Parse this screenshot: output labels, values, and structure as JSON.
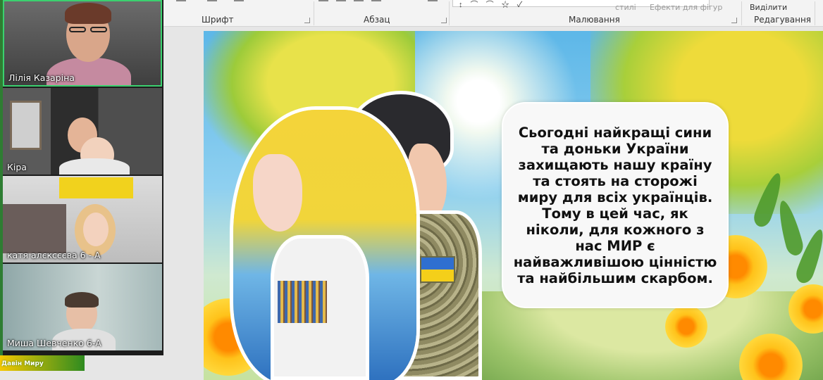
{
  "ribbon": {
    "groups": [
      {
        "label": "Шрифт"
      },
      {
        "label": "Абзац"
      },
      {
        "label": "Малювання"
      },
      {
        "label": "Редагування"
      }
    ],
    "styles_label": "стилі",
    "shape_effects_label": "Ефекти для фігур",
    "select_label": "Виділити"
  },
  "slide": {
    "text": "Сьогодні найкращі сини та доньки України захищають нашу країну та стоять на сторожі миру для всіх українців. Тому в цей час, як ніколи, для кожного з нас МИР є найважливішою цінністю та найбільшим скарбом."
  },
  "thumbnail": {
    "label": "Давін Миру"
  },
  "participants": [
    {
      "name": "Лілія Казаріна",
      "active": true
    },
    {
      "name": "Кіра",
      "active": false
    },
    {
      "name": "катя алєксєєва 6 - А",
      "active": false
    },
    {
      "name": "Миша Шевченко 6-А",
      "active": false
    }
  ],
  "colors": {
    "active_speaker_border": "#3bd16f",
    "panel_background": "#1c1c1c",
    "ribbon_background": "#f3f3f3"
  }
}
